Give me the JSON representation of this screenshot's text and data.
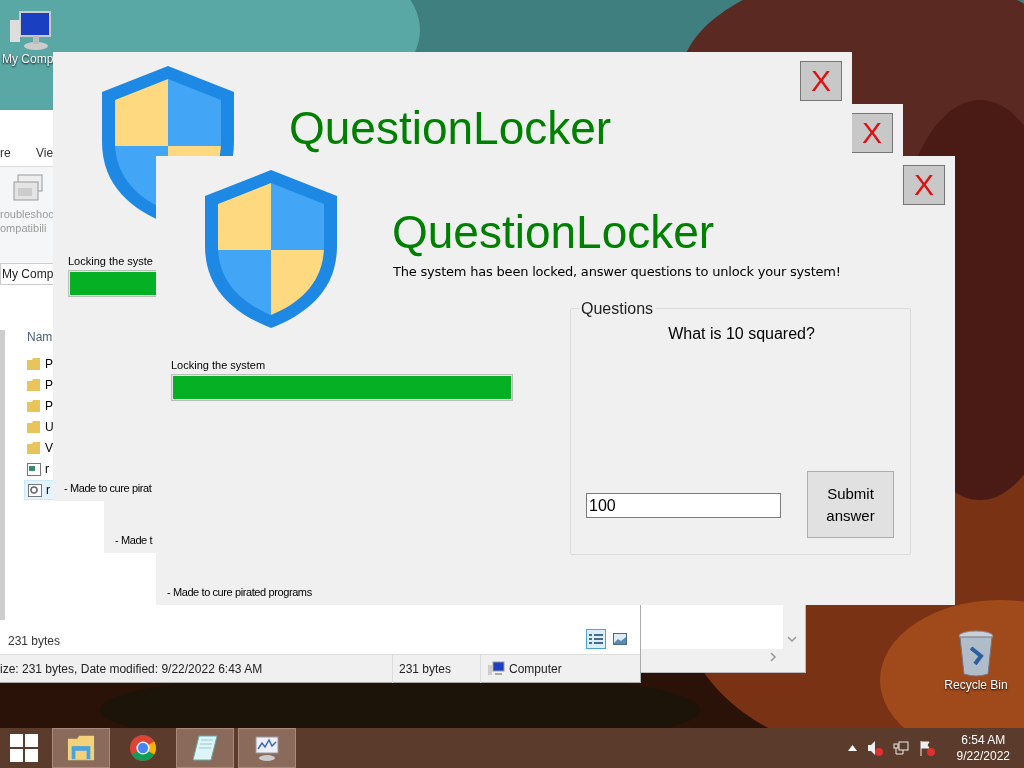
{
  "desktop_icons": [
    {
      "label": "My Comp",
      "kind": "computer"
    },
    {
      "label": "Recycle Bin",
      "kind": "bin"
    }
  ],
  "explorer": {
    "ribbon_tabs": [
      "re",
      "Vie"
    ],
    "ribbon_button": [
      "roubleshoo",
      "ompatibili"
    ],
    "address": "My Comp",
    "column": "Nam",
    "files": [
      {
        "name": "P",
        "kind": "folder",
        "selected": false
      },
      {
        "name": "P",
        "kind": "folder",
        "selected": false
      },
      {
        "name": "P",
        "kind": "folder",
        "selected": false
      },
      {
        "name": "U",
        "kind": "folder",
        "selected": false
      },
      {
        "name": "V",
        "kind": "folder",
        "selected": false
      },
      {
        "name": "r",
        "kind": "app",
        "selected": false
      },
      {
        "name": "r",
        "kind": "settings",
        "selected": true
      }
    ],
    "selection_size": "231 bytes",
    "view_buttons": [
      {
        "kind": "details",
        "selected": true
      },
      {
        "kind": "large",
        "selected": false
      }
    ],
    "status_bar": [
      "ize: 231 bytes, Date modified: 9/22/2022 6:43 AM",
      "231 bytes",
      "Computer"
    ]
  },
  "dialogs": [
    {
      "title": "QuestionLocker",
      "close": "X",
      "shield": true,
      "progress_label": "Locking the syste",
      "level": 1,
      "footer": "- Made to cure pirat"
    },
    {
      "close": "X",
      "footer": "- Made t"
    },
    {
      "title": "QuestionLocker",
      "close": "X",
      "shield": true,
      "subtitle": "The system has been locked, answer questions to unlock your system!",
      "progress_label": "Locking the system",
      "level": 1,
      "footer": "- Made to cure pirated programs",
      "questions": {
        "legend": "Questions",
        "question": "What is 10 squared?",
        "answer": "100",
        "submit": "Submit answer"
      }
    }
  ],
  "taskbar": {
    "apps": [
      {
        "kind": "start",
        "running": false
      },
      {
        "kind": "explorer",
        "running": true
      },
      {
        "kind": "chrome",
        "running": false
      },
      {
        "kind": "notepad",
        "running": true
      },
      {
        "kind": "monitor",
        "running": true
      }
    ],
    "clock": {
      "time": "6:54 AM",
      "date": "9/22/2022"
    }
  }
}
